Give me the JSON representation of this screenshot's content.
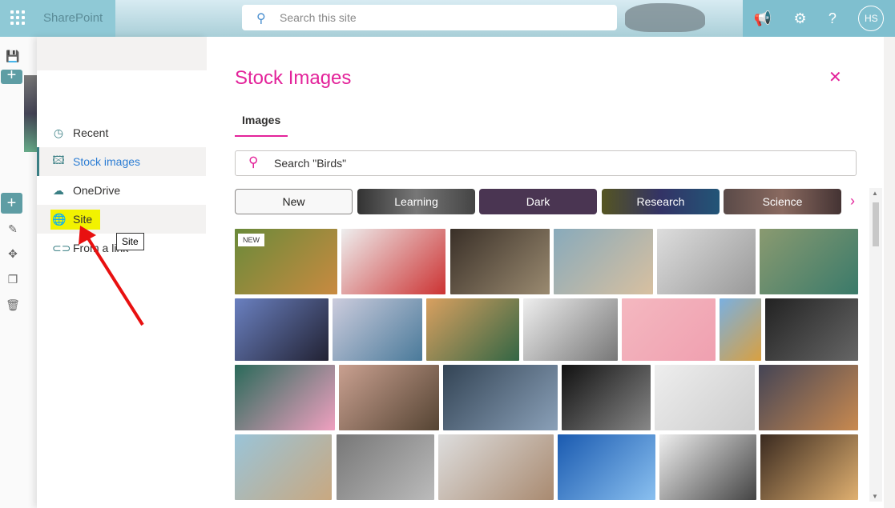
{
  "header": {
    "app_name": "SharePoint",
    "search_placeholder": "Search this site",
    "avatar_initials": "HS"
  },
  "nav": {
    "items": [
      {
        "label": "Recent",
        "icon": "clock-icon"
      },
      {
        "label": "Stock images",
        "icon": "image-search-icon",
        "selected": true
      },
      {
        "label": "OneDrive",
        "icon": "cloud-icon"
      },
      {
        "label": "Site",
        "icon": "globe-icon"
      },
      {
        "label": "From a link",
        "icon": "link-icon"
      }
    ],
    "tooltip": "Site"
  },
  "panel": {
    "title": "Stock Images",
    "tab": "Images",
    "search_placeholder": "Search \"Birds\"",
    "new_badge": "NEW",
    "categories": [
      "New",
      "Learning",
      "Dark",
      "Research",
      "Science"
    ]
  },
  "colors": {
    "accent": "#e3239a",
    "theme": "#3a7f84",
    "highlight": "#f2f200"
  }
}
